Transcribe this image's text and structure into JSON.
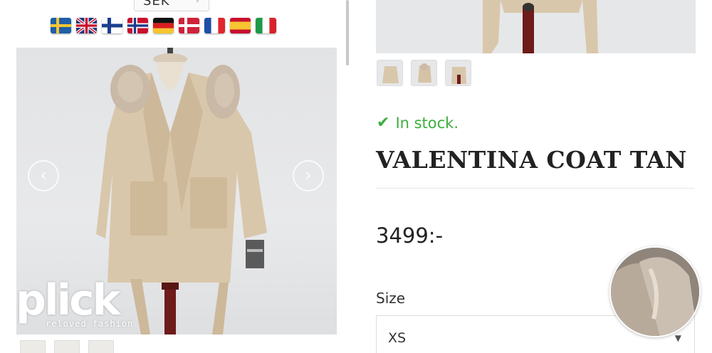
{
  "header": {
    "currency": "SEK",
    "flags": [
      "se",
      "gb",
      "fi",
      "no",
      "de",
      "dk",
      "fr",
      "es",
      "it"
    ]
  },
  "gallery": {
    "prev_icon": "chevron-left-icon",
    "next_icon": "chevron-right-icon",
    "prev_glyph": "‹",
    "next_glyph": "›"
  },
  "brand": {
    "logo_text": "plick",
    "tagline": "reloved fashion"
  },
  "product": {
    "stock_icon": "check-icon",
    "stock_text": "In stock.",
    "title": "VALENTINA COAT TAN",
    "price": "3499:-",
    "size_label": "Size",
    "size_selected": "XS"
  },
  "colors": {
    "stock_green": "#3cae3c",
    "coat": "#d9c7ab",
    "background": "#ffffff"
  }
}
